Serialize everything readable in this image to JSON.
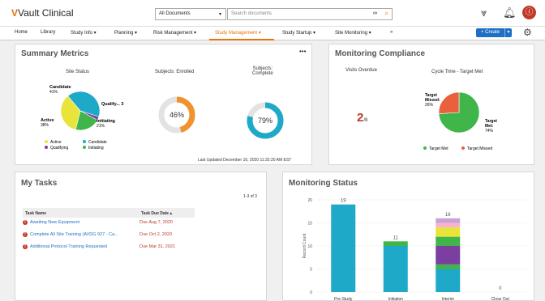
{
  "header": {
    "logo_mark": "V",
    "logo_text": "Vault Clinical",
    "doc_select": "All Documents",
    "search_placeholder": "Search documents"
  },
  "nav": {
    "items": [
      "Home",
      "Library",
      "Study Info ▾",
      "Planning ▾",
      "Risk Management ▾",
      "Study Management ▾",
      "Study Startup ▾",
      "Site Monitoring ▾",
      "»"
    ],
    "active_index": 5,
    "create_label": "+ Create",
    "create_caret": "▾"
  },
  "summary": {
    "title": "Summary Metrics",
    "menu": "•••",
    "site_status": {
      "title": "Site Status",
      "slices": [
        {
          "label": "Candidate",
          "pct_label": "41%",
          "value": 41,
          "color": "#1fa9c9"
        },
        {
          "label": "Qualify... 3",
          "pct_label": "",
          "value": 3,
          "color": "#7b3fa0"
        },
        {
          "label": "Initiating",
          "pct_label": "21%",
          "value": 21,
          "color": "#3fb54a"
        },
        {
          "label": "Active",
          "pct_label": "38%",
          "value": 35,
          "color": "#e8e43a"
        }
      ],
      "legend": [
        "Active",
        "Candidate",
        "Qualifying",
        "Initiating"
      ]
    },
    "enrolled": {
      "title": "Subjects: Enrolled",
      "value": 46,
      "label": "46%",
      "color": "#f0922f"
    },
    "complete": {
      "title": "Subjects:\nComplete",
      "title_l1": "Subjects:",
      "title_l2": "Complete",
      "value": 79,
      "label": "79%",
      "color": "#1fa9c9"
    },
    "updated": "Last Updated December 10, 2020 11:32:20 AM EST"
  },
  "compliance": {
    "title": "Monitoring Compliance",
    "visits_title": "Visits Overdue",
    "visits_value": "2",
    "visits_suffix": "/8",
    "cycle_title": "Cycle Time - Target Met",
    "slices": [
      {
        "label": "Target Met",
        "pct_label": "74%",
        "value": 74,
        "color": "#3fb54a"
      },
      {
        "label": "Target Missed",
        "pct_label": "26%",
        "value": 26,
        "color": "#e8603c"
      }
    ],
    "label_missed_l1": "Target",
    "label_missed_l2": "Missed:",
    "label_missed_l3": "26%",
    "label_met_l1": "Target",
    "label_met_l2": "Met:",
    "label_met_l3": "74%",
    "legend": [
      "Target Met",
      "Target Missed"
    ]
  },
  "tasks": {
    "title": "My Tasks",
    "count": "1-3 of 3",
    "col_name": "Task Name",
    "col_date": "Task Due Date ▴",
    "rows": [
      {
        "name": "Awaiting New Equipment",
        "date": "Due Aug 7, 2020"
      },
      {
        "name": "Complete All Site Training (AVDG 927 - Ca...",
        "date": "Due Oct 2, 2020"
      },
      {
        "name": "Additional Protocol Training Requested",
        "date": "Due Mar 31, 2021"
      }
    ]
  },
  "monitoring_status": {
    "title": "Monitoring Status"
  },
  "chart_data": {
    "type": "bar",
    "title": "Monitoring Status",
    "categories": [
      "Pre-Study",
      "Initiation",
      "Interim",
      "Close Out"
    ],
    "ylabel": "Record Count",
    "ylim": [
      0,
      20
    ],
    "yticks": [
      0,
      5,
      10,
      15,
      20
    ],
    "totals": [
      19,
      11,
      16,
      0
    ],
    "series": [
      {
        "color": "#1fa9c9",
        "values": [
          19,
          10,
          5,
          0
        ]
      },
      {
        "color": "#3fb54a",
        "values": [
          0,
          1,
          1,
          0
        ]
      },
      {
        "color": "#7b3fa0",
        "values": [
          0,
          0,
          4,
          0
        ]
      },
      {
        "color": "#3fb54a",
        "values": [
          0,
          0,
          2,
          0
        ]
      },
      {
        "color": "#e8e43a",
        "values": [
          0,
          0,
          2,
          0
        ]
      },
      {
        "color": "#f5b7c8",
        "values": [
          0,
          0,
          1,
          0
        ]
      },
      {
        "color": "#c9a2d9",
        "values": [
          0,
          0,
          1,
          0
        ]
      }
    ]
  }
}
